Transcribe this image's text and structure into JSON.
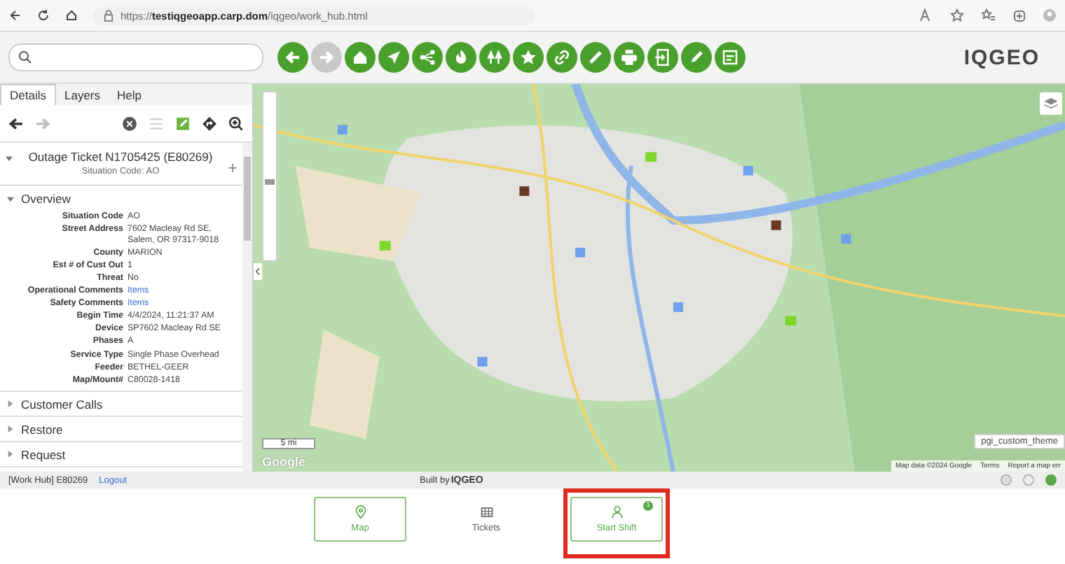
{
  "browser": {
    "url": "https://**testiqgeoapp.carp.dom**/iqgeo/work_hub.html"
  },
  "toolbar": {
    "buttons": [
      {
        "kind": "back",
        "disabled": false
      },
      {
        "kind": "forward",
        "disabled": true
      },
      {
        "kind": "home",
        "disabled": false
      },
      {
        "kind": "navigate",
        "disabled": false
      },
      {
        "kind": "share",
        "disabled": false
      },
      {
        "kind": "fire",
        "disabled": false
      },
      {
        "kind": "trees",
        "disabled": false
      },
      {
        "kind": "star",
        "disabled": false
      },
      {
        "kind": "link",
        "disabled": false
      },
      {
        "kind": "ruler",
        "disabled": false
      },
      {
        "kind": "print",
        "disabled": false
      },
      {
        "kind": "export",
        "disabled": false
      },
      {
        "kind": "pencil",
        "disabled": false
      },
      {
        "kind": "note",
        "disabled": false
      }
    ],
    "logo": "IQGEO"
  },
  "tabs": [
    {
      "label": "Details",
      "selected": true
    },
    {
      "label": "Layers",
      "selected": false
    },
    {
      "label": "Help",
      "selected": false
    }
  ],
  "details": {
    "title": "Outage Ticket N1705425 (E80269)",
    "subtitle": "Situation Code: AO",
    "overview": {
      "label": "Overview",
      "expanded": true,
      "fields": [
        {
          "label": "Situation Code",
          "value": "AO",
          "kind": "text"
        },
        {
          "label": "Street Address",
          "value": "7602 Macleay Rd SE, Salem, OR 97317-9018",
          "kind": "text"
        },
        {
          "label": "County",
          "value": "MARION",
          "kind": "text"
        },
        {
          "label": "Est # of Cust Out",
          "value": "1",
          "kind": "text"
        },
        {
          "label": "Threat",
          "value": "No",
          "kind": "text"
        },
        {
          "label": "Operational Comments",
          "value": "Items",
          "kind": "link"
        },
        {
          "label": "Safety Comments",
          "value": "Items",
          "kind": "link"
        },
        {
          "label": "Begin Time",
          "value": "4/4/2024, 11:21:37 AM",
          "kind": "text"
        },
        {
          "label": "Device",
          "value": "SP7602 Macleay Rd SE",
          "kind": "text"
        },
        {
          "label": "Phases",
          "value": "A",
          "kind": "text"
        },
        {
          "label": "Service Type",
          "value": "Single Phase Overhead",
          "kind": "text"
        },
        {
          "label": "Feeder",
          "value": "BETHEL-GEER",
          "kind": "text"
        },
        {
          "label": "Map/Mount#",
          "value": "C80028-1418",
          "kind": "text"
        }
      ]
    },
    "sections": [
      {
        "label": "Customer Calls",
        "expanded": false
      },
      {
        "label": "Restore",
        "expanded": false
      },
      {
        "label": "Request",
        "expanded": false
      }
    ]
  },
  "map": {
    "zoom": {
      "level": 0.45
    },
    "scale": "5 mi",
    "google": "Google",
    "theme": "pgi_custom_theme",
    "attribution": [
      "Map data ©2024 Google",
      "Terms",
      "Report a map err"
    ]
  },
  "status_bar": {
    "context": "[Work Hub] E80269",
    "logout": "Logout",
    "built_by": "Built by",
    "brand": "IQGEO"
  },
  "nav": [
    {
      "label": "Map",
      "kind": "map",
      "selected": true
    },
    {
      "label": "Tickets",
      "kind": "tickets",
      "selected": false
    },
    {
      "label": "Start Shift",
      "kind": "shift",
      "selected": true,
      "badge": "1",
      "highlighted": true
    }
  ]
}
